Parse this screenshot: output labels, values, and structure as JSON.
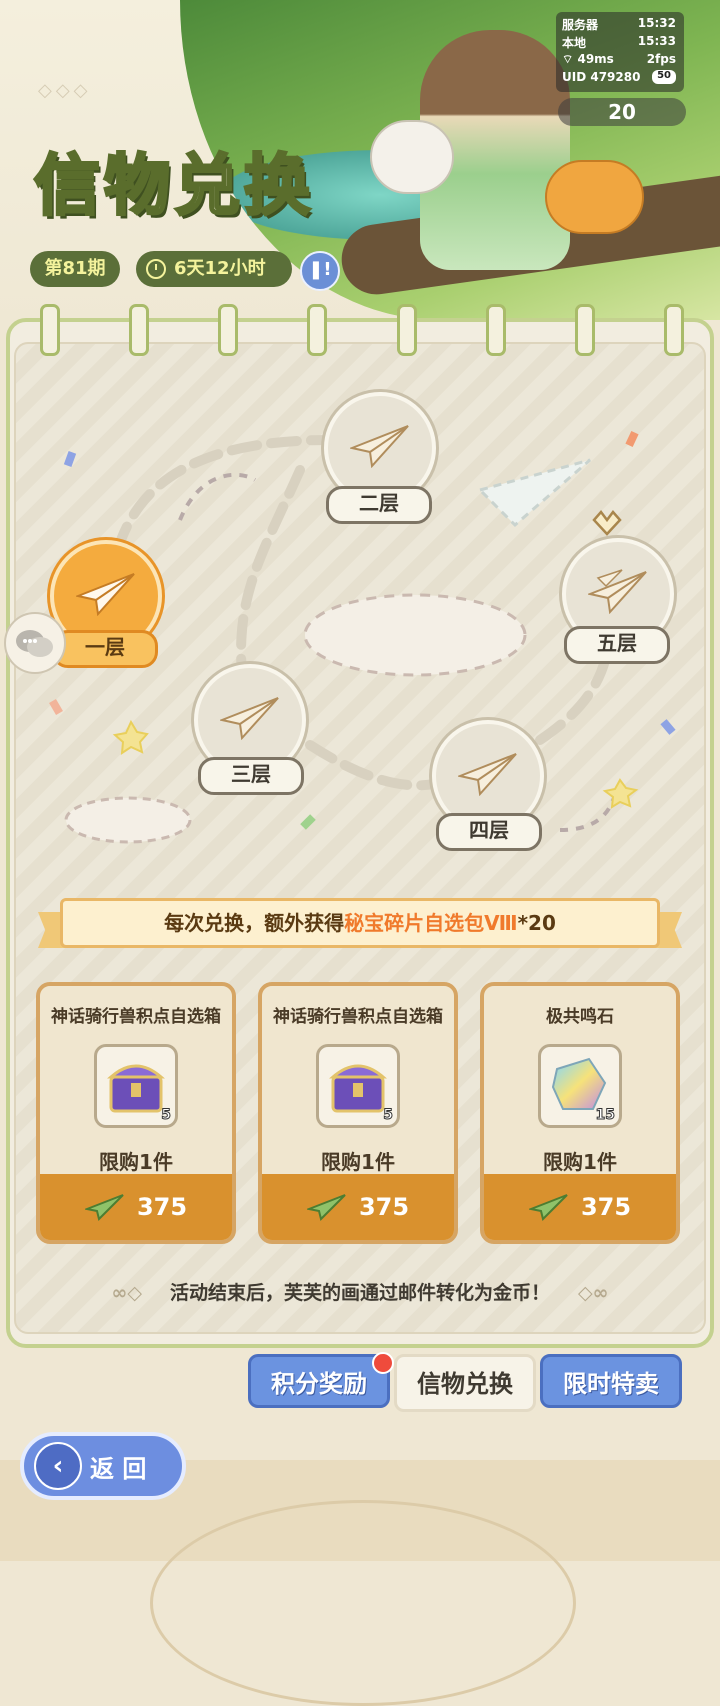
{
  "hud": {
    "server_label": "服务器",
    "server_time": "15:32",
    "local_label": "本地",
    "local_time": "15:33",
    "ping": "49ms",
    "fps": "2fps",
    "uid_label": "UID",
    "uid": "479280",
    "uid_badge": "50"
  },
  "currency": {
    "amount": "20"
  },
  "header": {
    "title": "信物兑换",
    "period": "第81期",
    "countdown": "6天12小时",
    "info_icon": "info-book-icon"
  },
  "map": {
    "floors": [
      {
        "label": "一层",
        "active": true
      },
      {
        "label": "二层",
        "active": false
      },
      {
        "label": "三层",
        "active": false
      },
      {
        "label": "四层",
        "active": false
      },
      {
        "label": "五层",
        "active": false
      }
    ]
  },
  "banner": {
    "prefix": "每次兑换，额外获得",
    "highlight": "秘宝碎片自选包Ⅷ",
    "suffix": "*20"
  },
  "shop": {
    "items": [
      {
        "name": "神话骑行兽积点自选箱",
        "quantity": "5",
        "limit": "限购1件",
        "price": "375",
        "icon": "treasure-chest-icon"
      },
      {
        "name": "神话骑行兽积点自选箱",
        "quantity": "5",
        "limit": "限购1件",
        "price": "375",
        "icon": "treasure-chest-icon"
      },
      {
        "name": "极共鸣石",
        "quantity": "15",
        "limit": "限购1件",
        "price": "375",
        "icon": "resonance-stone-icon"
      }
    ]
  },
  "footer_note": "活动结束后，芙芙的画通过邮件转化为金币！",
  "tabs": [
    {
      "label": "积分奖励",
      "selected": false,
      "badge": true
    },
    {
      "label": "信物兑换",
      "selected": true,
      "badge": false
    },
    {
      "label": "限时特卖",
      "selected": false,
      "badge": false
    }
  ],
  "back_button": {
    "label": "返 回"
  },
  "colors": {
    "accent_orange": "#f4ab3e",
    "highlight": "#f07a2c",
    "tab_blue": "#6b93e0",
    "title_green": "#5b6f39"
  }
}
